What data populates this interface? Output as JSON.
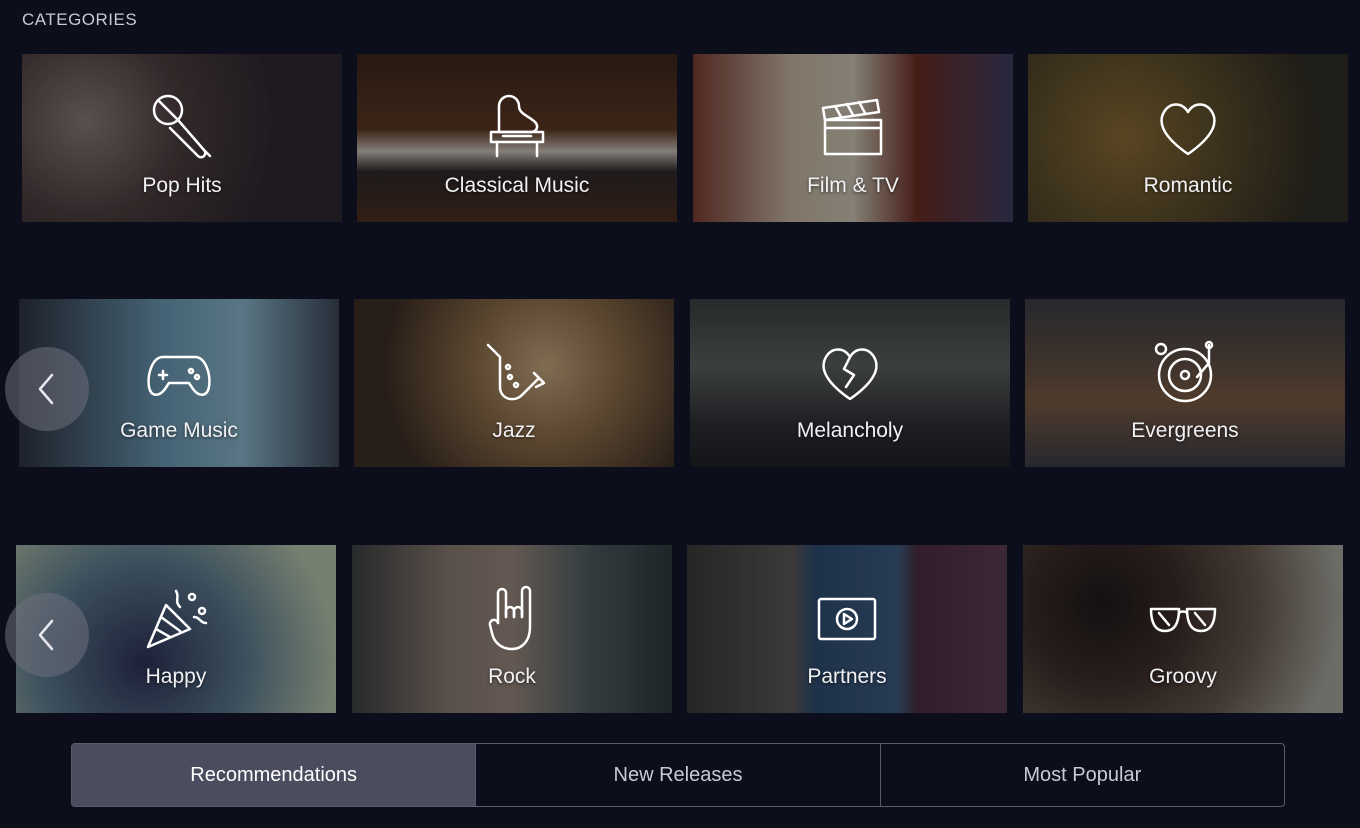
{
  "header": {
    "title": "CATEGORIES"
  },
  "rows": [
    [
      {
        "label": "Pop Hits",
        "icon": "microphone-icon"
      },
      {
        "label": "Classical Music",
        "icon": "piano-icon"
      },
      {
        "label": "Film & TV",
        "icon": "clapperboard-icon"
      },
      {
        "label": "Romantic",
        "icon": "heart-icon"
      }
    ],
    [
      {
        "label": "Game Music",
        "icon": "gamepad-icon"
      },
      {
        "label": "Jazz",
        "icon": "saxophone-icon"
      },
      {
        "label": "Melancholy",
        "icon": "broken-heart-icon"
      },
      {
        "label": "Evergreens",
        "icon": "turntable-icon"
      }
    ],
    [
      {
        "label": "Happy",
        "icon": "party-popper-icon"
      },
      {
        "label": "Rock",
        "icon": "rock-hand-icon"
      },
      {
        "label": "Partners",
        "icon": "play-video-icon"
      },
      {
        "label": "Groovy",
        "icon": "sunglasses-icon"
      }
    ]
  ],
  "tabs": [
    {
      "label": "Recommendations",
      "active": true
    },
    {
      "label": "New Releases",
      "active": false
    },
    {
      "label": "Most Popular",
      "active": false
    }
  ],
  "colors": {
    "background": "#0d0e1c",
    "active_tab": "#4b4d5e",
    "tab_border": "#5a5c6c"
  }
}
